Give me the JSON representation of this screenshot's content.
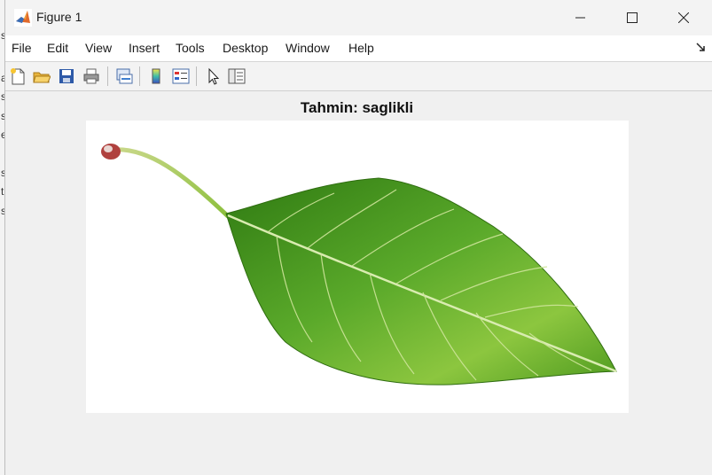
{
  "window": {
    "title": "Figure 1"
  },
  "background_window": {
    "glyphs": [
      "s",
      "a",
      "s",
      "s",
      "e",
      "s",
      "t",
      "s"
    ]
  },
  "menu": {
    "items": [
      "File",
      "Edit",
      "View",
      "Insert",
      "Tools",
      "Desktop",
      "Window",
      "Help"
    ]
  },
  "toolbar": {
    "buttons": [
      "new-figure-icon",
      "open-file-icon",
      "save-icon",
      "print-icon",
      "link-plot-icon",
      "colorbar-icon",
      "legend-icon",
      "pointer-icon",
      "property-inspector-icon"
    ]
  },
  "plot": {
    "title": "Tahmin: saglikli",
    "image_subject": "leaf-image"
  },
  "colors": {
    "leaf_dark": "#2f7a12",
    "leaf_light": "#8cc63f",
    "vein": "#d9ecb0",
    "stem_tip": "#b0413e"
  }
}
